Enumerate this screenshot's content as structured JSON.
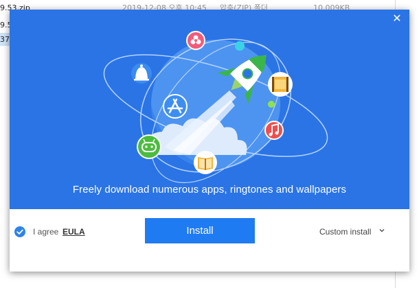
{
  "background_window": {
    "rows": [
      {
        "name": "9.53.zip",
        "date": "2019-12-08 오후 10:45",
        "type": "압축(ZIP) 폴더",
        "size": "10,009KB"
      },
      {
        "name": "9.5",
        "date": "",
        "type": "",
        "size": ""
      },
      {
        "name": "37",
        "date": "",
        "type": "",
        "size": ""
      }
    ]
  },
  "dialog": {
    "close_glyph": "✕",
    "tagline": "Freely download numerous apps, ringtones and wallpapers",
    "agree_label": "I agree",
    "eula_label": "EULA",
    "install_label": "Install",
    "custom_install_label": "Custom install",
    "icons": [
      "rocket-icon",
      "app-store-icon",
      "notification-bell-icon",
      "flower-icon",
      "video-film-icon",
      "music-note-icon",
      "book-icon",
      "android-robot-icon",
      "checkmark-icon",
      "chevron-down-icon",
      "close-icon"
    ]
  },
  "colors": {
    "banner": "#2a74e6",
    "install_button": "#1f7bf2",
    "checkbox": "#2e83e8"
  }
}
